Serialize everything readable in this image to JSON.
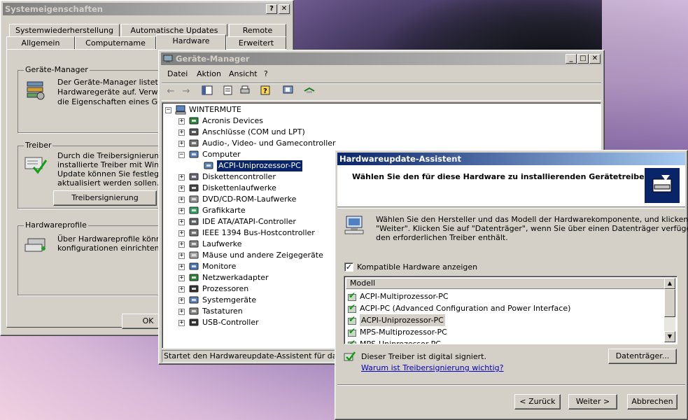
{
  "sysprops": {
    "title": "Systemeigenschaften",
    "tabs_back": [
      "Systemwiederherstellung",
      "Automatische Updates",
      "Remote"
    ],
    "tabs_front": [
      "Allgemein",
      "Computername",
      "Hardware",
      "Erweitert"
    ],
    "geraete_manager_group": "Geräte-Manager",
    "geraete_manager_text": [
      "Der Geräte-Manager listet alle",
      "Hardwaregeräte auf. Verwende",
      "die Eigenschaften eines Gerät"
    ],
    "treiber_group": "Treiber",
    "treiber_text": [
      "Durch die Treibersignierung ka",
      "installierte Treiber mit Windows",
      "Update können Sie festlegen,",
      "aktualisiert werden sollen."
    ],
    "treibersignierung_button": "Treibersignierung",
    "hwprofile_group": "Hardwareprofile",
    "hwprofile_text": [
      "Über Hardwareprofile können S",
      "konfigurationen einrichten und"
    ],
    "ok_button": "OK"
  },
  "devmgr": {
    "title": "Geräte-Manager",
    "menu": [
      "Datei",
      "Aktion",
      "Ansicht",
      "?"
    ],
    "root": "WINTERMUTE",
    "items": [
      {
        "label": "Acronis Devices",
        "icon": "device-icon"
      },
      {
        "label": "Anschlüsse (COM und LPT)",
        "icon": "port-icon"
      },
      {
        "label": "Audio-, Video- und Gamecontroller",
        "icon": "audio-icon"
      },
      {
        "label": "Computer",
        "icon": "computer-icon",
        "expanded": true
      },
      {
        "label": "ACPI-Uniprozessor-PC",
        "icon": "computer-icon",
        "child": true,
        "selected": true
      },
      {
        "label": "Diskettencontroller",
        "icon": "controller-icon"
      },
      {
        "label": "Diskettenlaufwerke",
        "icon": "floppy-icon"
      },
      {
        "label": "DVD/CD-ROM-Laufwerke",
        "icon": "cdrom-icon"
      },
      {
        "label": "Grafikkarte",
        "icon": "display-adapter-icon"
      },
      {
        "label": "IDE ATA/ATAPI-Controller",
        "icon": "ide-icon"
      },
      {
        "label": "IEEE 1394 Bus-Hostcontroller",
        "icon": "firewire-icon"
      },
      {
        "label": "Laufwerke",
        "icon": "disk-icon"
      },
      {
        "label": "Mäuse und andere Zeigegeräte",
        "icon": "mouse-icon"
      },
      {
        "label": "Monitore",
        "icon": "monitor-icon"
      },
      {
        "label": "Netzwerkadapter",
        "icon": "network-icon"
      },
      {
        "label": "Prozessoren",
        "icon": "cpu-icon"
      },
      {
        "label": "Systemgeräte",
        "icon": "system-icon"
      },
      {
        "label": "Tastaturen",
        "icon": "keyboard-icon"
      },
      {
        "label": "USB-Controller",
        "icon": "usb-icon"
      }
    ],
    "status": "Startet den Hardwareupdate-Assistent für das ausg"
  },
  "wizard": {
    "title": "Hardwareupdate-Assistent",
    "heading": "Wählen Sie den für diese Hardware zu installierenden Gerätetreiber.",
    "intro_lines": [
      "Wählen Sie den Hersteller und das Modell der Hardwarekomponente, und klicken Sie auf",
      "\"Weiter\". Klicken Sie auf \"Datenträger\", wenn Sie über einen Datenträger verfügen, der",
      "den erforderlichen Treiber enthält."
    ],
    "compat_checkbox": "Kompatible Hardware anzeigen",
    "compat_checked": true,
    "list_header": "Modell",
    "models": [
      "ACPI-Multiprozessor-PC",
      "ACPI-PC (Advanced Configuration and Power Interface)",
      "ACPI-Uniprozessor-PC",
      "MPS-Multiprozessor-PC",
      "MPS-Uniprozessor-PC"
    ],
    "selected_model": 2,
    "signed_text": "Dieser Treiber ist digital signiert.",
    "signing_link": "Warum ist Treibersignierung wichtig?",
    "datentraeger_button": "Datenträger...",
    "back_button": "< Zurück",
    "next_button": "Weiter >",
    "cancel_button": "Abbrechen"
  }
}
